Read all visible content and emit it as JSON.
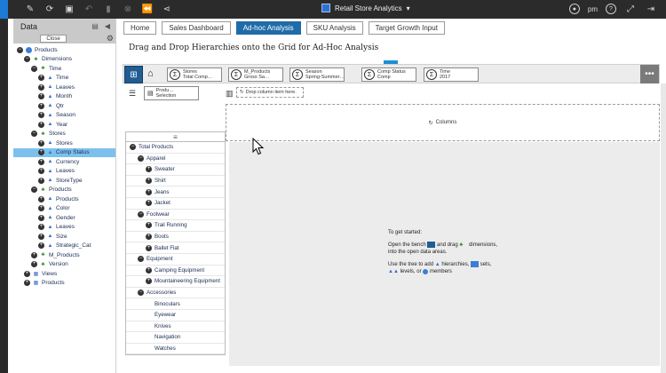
{
  "topbar": {
    "app_title": "Retail Store Analytics",
    "user": "pm",
    "icons": [
      "pencil-icon",
      "refresh-icon",
      "save-icon",
      "undo-icon",
      "bookmark-icon",
      "close-icon",
      "rewind-icon",
      "share-icon"
    ]
  },
  "data_panel": {
    "title": "Data",
    "close_label": "Close",
    "tree": [
      {
        "label": "Products",
        "depth": 0,
        "toggle": "−",
        "icon": "cube"
      },
      {
        "label": "Dimensions",
        "depth": 1,
        "toggle": "−",
        "icon": "dim"
      },
      {
        "label": "Time",
        "depth": 2,
        "toggle": "−",
        "icon": "hier"
      },
      {
        "label": "Time",
        "depth": 3,
        "toggle": "+",
        "icon": "lvl"
      },
      {
        "label": "Leaves",
        "depth": 3,
        "toggle": "+",
        "icon": "lvl"
      },
      {
        "label": "Month",
        "depth": 3,
        "toggle": "+",
        "icon": "lvl"
      },
      {
        "label": "Qtr",
        "depth": 3,
        "toggle": "+",
        "icon": "lvl"
      },
      {
        "label": "Season",
        "depth": 3,
        "toggle": "+",
        "icon": "lvl"
      },
      {
        "label": "Year",
        "depth": 3,
        "toggle": "+",
        "icon": "lvl"
      },
      {
        "label": "Stores",
        "depth": 2,
        "toggle": "−",
        "icon": "hier"
      },
      {
        "label": "Stores",
        "depth": 3,
        "toggle": "+",
        "icon": "lvl"
      },
      {
        "label": "Comp Status",
        "depth": 3,
        "toggle": "+",
        "icon": "lvl",
        "selected": true
      },
      {
        "label": "Currency",
        "depth": 3,
        "toggle": "+",
        "icon": "lvl"
      },
      {
        "label": "Leaves",
        "depth": 3,
        "toggle": "+",
        "icon": "lvl"
      },
      {
        "label": "StoreType",
        "depth": 3,
        "toggle": "+",
        "icon": "lvl"
      },
      {
        "label": "Products",
        "depth": 2,
        "toggle": "−",
        "icon": "hier"
      },
      {
        "label": "Products",
        "depth": 3,
        "toggle": "+",
        "icon": "lvl"
      },
      {
        "label": "Color",
        "depth": 3,
        "toggle": "+",
        "icon": "lvl"
      },
      {
        "label": "Gender",
        "depth": 3,
        "toggle": "+",
        "icon": "lvl"
      },
      {
        "label": "Leaves",
        "depth": 3,
        "toggle": "+",
        "icon": "lvl"
      },
      {
        "label": "Size",
        "depth": 3,
        "toggle": "+",
        "icon": "lvl"
      },
      {
        "label": "Strategic_Cat",
        "depth": 3,
        "toggle": "+",
        "icon": "lvl"
      },
      {
        "label": "M_Products",
        "depth": 2,
        "toggle": "+",
        "icon": "hier"
      },
      {
        "label": "Version",
        "depth": 2,
        "toggle": "+",
        "icon": "hier"
      },
      {
        "label": "Views",
        "depth": 1,
        "toggle": "+",
        "icon": "view"
      },
      {
        "label": "Products",
        "depth": 1,
        "toggle": "+",
        "icon": "prods"
      }
    ]
  },
  "tabs": [
    {
      "label": "Home",
      "active": false
    },
    {
      "label": "Sales Dashboard",
      "active": false
    },
    {
      "label": "Ad-hoc Analysis",
      "active": true
    },
    {
      "label": "SKU Analysis",
      "active": false
    },
    {
      "label": "Target Growth Input",
      "active": false
    }
  ],
  "page_title": "Drag and Drop Hierarchies onto the Grid for  Ad-Hoc Analysis",
  "bench": {
    "chips": [
      {
        "line1": "Stores",
        "line2": "Total Comp…"
      },
      {
        "line1": "M_Products",
        "line2": "Gross Sa…"
      },
      {
        "line1": "Season",
        "line2": "Spring-Summer…"
      },
      {
        "line1": "Comp Status",
        "line2": "Comp"
      },
      {
        "line1": "Time",
        "line2": "2017"
      }
    ],
    "more_label": "•••"
  },
  "row_tools": {
    "selection_chip": {
      "line1": "Produ…",
      "line2": "Selection"
    },
    "drop_column_label": "Drop column item here."
  },
  "columns_zone_label": "Columns",
  "rows": [
    {
      "label": "Total Products",
      "depth": 0,
      "toggle": "−"
    },
    {
      "label": "Apparel",
      "depth": 1,
      "toggle": "−"
    },
    {
      "label": "Sweater",
      "depth": 2,
      "toggle": "+"
    },
    {
      "label": "Shirt",
      "depth": 2,
      "toggle": "+"
    },
    {
      "label": "Jeans",
      "depth": 2,
      "toggle": "+"
    },
    {
      "label": "Jacket",
      "depth": 2,
      "toggle": "+"
    },
    {
      "label": "Footwear",
      "depth": 1,
      "toggle": "−"
    },
    {
      "label": "Trail Running",
      "depth": 2,
      "toggle": "+"
    },
    {
      "label": "Boots",
      "depth": 2,
      "toggle": "+"
    },
    {
      "label": "Ballet Flat",
      "depth": 2,
      "toggle": "+"
    },
    {
      "label": "Equipment",
      "depth": 1,
      "toggle": "−"
    },
    {
      "label": "Camping Equipment",
      "depth": 2,
      "toggle": "+"
    },
    {
      "label": "Mountaineering Equipment",
      "depth": 2,
      "toggle": "+"
    },
    {
      "label": "Accessories",
      "depth": 1,
      "toggle": "−"
    },
    {
      "label": "Binoculars",
      "depth": 2,
      "toggle": ""
    },
    {
      "label": "Eyewear",
      "depth": 2,
      "toggle": ""
    },
    {
      "label": "Knives",
      "depth": 2,
      "toggle": ""
    },
    {
      "label": "Navigation",
      "depth": 2,
      "toggle": ""
    },
    {
      "label": "Watches",
      "depth": 2,
      "toggle": ""
    }
  ],
  "help": {
    "line1": "To get started:",
    "line2a": "Open the bench",
    "line2b": "and drag",
    "line2c": "dimensions,",
    "line3": "into the open data areas.",
    "line4a": "Use the tree to add",
    "line4b": "hierarchies,",
    "line4c": "sets,",
    "line5a": "levels, or",
    "line5b": "members"
  },
  "colors": {
    "accent": "#1f6ca8",
    "selected_row": "#7cc1ee",
    "topbar": "#2b2b2b"
  }
}
